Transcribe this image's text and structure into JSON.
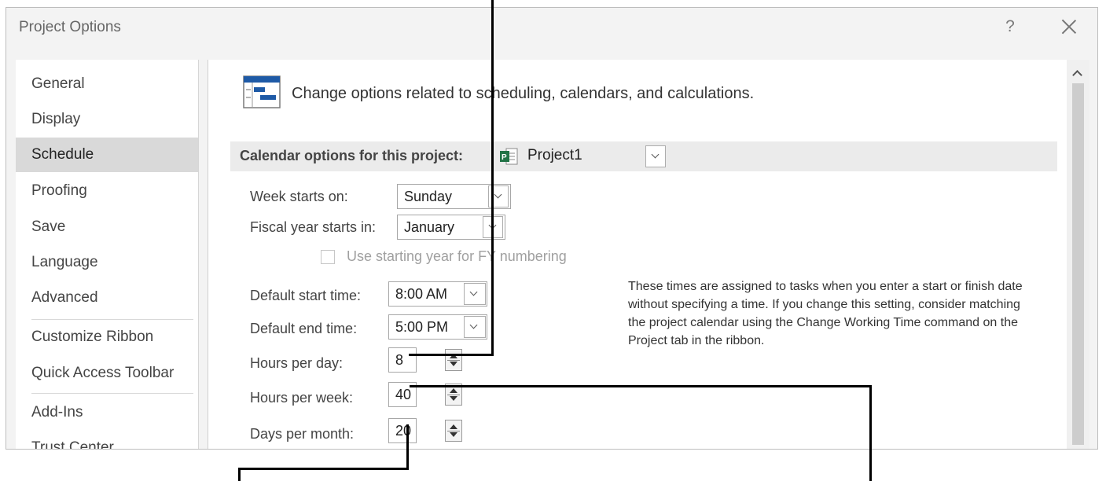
{
  "window": {
    "title": "Project Options",
    "help_label": "?"
  },
  "sidebar": {
    "items": [
      {
        "label": "General"
      },
      {
        "label": "Display"
      },
      {
        "label": "Schedule",
        "selected": true
      },
      {
        "label": "Proofing"
      },
      {
        "label": "Save"
      },
      {
        "label": "Language"
      },
      {
        "label": "Advanced"
      },
      {
        "label": "Customize Ribbon"
      },
      {
        "label": "Quick Access Toolbar"
      },
      {
        "label": "Add-Ins"
      },
      {
        "label": "Trust Center"
      }
    ]
  },
  "main": {
    "header": "Change options related to scheduling, calendars, and calculations.",
    "section": {
      "label": "Calendar options for this project:",
      "project": "Project1"
    },
    "week_starts": {
      "label": "Week starts on:",
      "value": "Sunday"
    },
    "fiscal_year": {
      "label": "Fiscal year starts in:",
      "value": "January"
    },
    "fy_numbering": {
      "label": "Use starting year for FY numbering",
      "checked": false
    },
    "default_start": {
      "label": "Default start time:",
      "value": "8:00 AM"
    },
    "default_end": {
      "label": "Default end time:",
      "value": "5:00 PM"
    },
    "hours_per_day": {
      "label": "Hours per day:",
      "value": "8"
    },
    "hours_per_week": {
      "label": "Hours per week:",
      "value": "40"
    },
    "days_per_month": {
      "label": "Days per month:",
      "value": "20"
    },
    "description": "These times are assigned to tasks when you enter a start or finish date without specifying a time. If you change this setting, consider matching the project calendar using the Change Working Time command on the Project tab in the ribbon."
  },
  "colors": {
    "selected_nav": "#d9d9d9",
    "project_icon": "#217346",
    "header_icon": "#1e5aa6"
  }
}
